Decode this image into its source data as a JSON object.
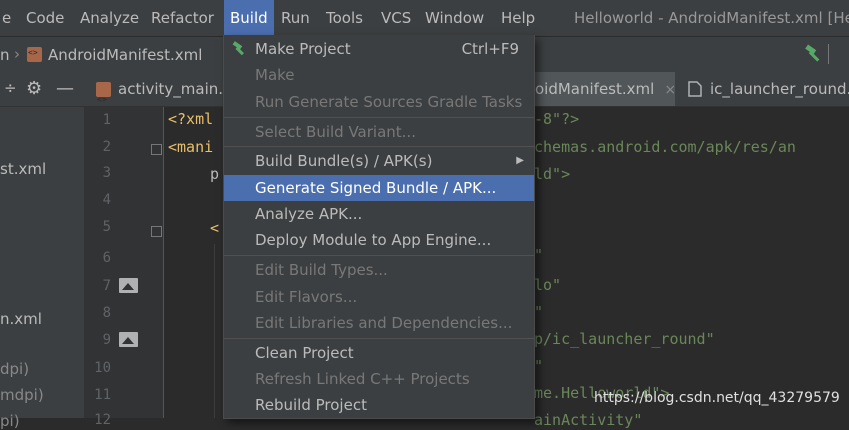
{
  "menubar": {
    "items": [
      "e",
      "Code",
      "Analyze",
      "Refactor",
      "Build",
      "Run",
      "Tools",
      "VCS",
      "Window",
      "Help"
    ],
    "window_title": "Helloworld - AndroidManifest.xml [He"
  },
  "navbar": {
    "crumb_partial": "n",
    "file": "AndroidManifest.xml"
  },
  "tabs": {
    "tab1": "activity_main.x",
    "tab2": "oidManifest.xml",
    "tab2_close": "×",
    "tab3": "ic_launcher_round.p"
  },
  "project": {
    "items": [
      "st.xml",
      "n.xml",
      "dpi)",
      "mdpi)",
      "pi)"
    ]
  },
  "gutter": {
    "lines": [
      "1",
      "2",
      "3",
      "4",
      "5",
      "6",
      "7",
      "8",
      "9",
      "10",
      "11",
      "12"
    ]
  },
  "code": {
    "l1a": "<?xml",
    "l1b": "-8\"?>",
    "l2a": "<mani",
    "l2b": "chemas.android.com/apk/res/an",
    "l3a": "p",
    "l3b": "ld\">",
    "l5a": "<",
    "l6b": "\"",
    "l7b": "lo\"",
    "l8b": "\"",
    "l9b": "p/ic_launcher_round\"",
    "l10b": "\"",
    "l11b": "me.Helloworld\">",
    "l12b": "ainActivity\""
  },
  "build_menu": {
    "items": [
      {
        "label": "Make Project",
        "shortcut": "Ctrl+F9"
      },
      {
        "label": "Make"
      },
      {
        "label": "Run Generate Sources Gradle Tasks"
      },
      {
        "label": "Select Build Variant..."
      },
      {
        "label": "Build Bundle(s) / APK(s)",
        "submenu": "▶"
      },
      {
        "label": "Generate Signed Bundle / APK..."
      },
      {
        "label": "Analyze APK..."
      },
      {
        "label": "Deploy Module to App Engine..."
      },
      {
        "label": "Edit Build Types..."
      },
      {
        "label": "Edit Flavors..."
      },
      {
        "label": "Edit Libraries and Dependencies..."
      },
      {
        "label": "Clean Project"
      },
      {
        "label": "Refresh Linked C++ Projects"
      },
      {
        "label": "Rebuild Project"
      }
    ]
  },
  "watermark": "https://blog.csdn.net/qq_43279579",
  "colors": {
    "menu_highlight": "#4b6eaf",
    "hammer_green": "#59a869"
  }
}
